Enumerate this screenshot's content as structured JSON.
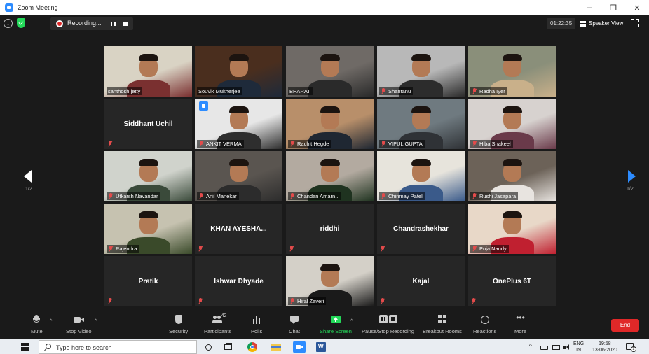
{
  "window": {
    "title": "Zoom Meeting",
    "controls": [
      "–",
      "❐",
      "✕"
    ]
  },
  "topbar": {
    "recording_label": "Recording...",
    "timer": "01:22:35",
    "view_label": "Speaker View"
  },
  "pager": {
    "left": "1/2",
    "right": "1/2"
  },
  "participants": [
    {
      "name": "santhosh jetty",
      "video": true,
      "muted": false,
      "colors": [
        "#d9d3c4",
        "#7a3030"
      ]
    },
    {
      "name": "Souvik Mukherjee",
      "video": true,
      "muted": false,
      "active": true,
      "colors": [
        "#4a2e1e",
        "#1e2a3a"
      ]
    },
    {
      "name": "BHARAT",
      "video": true,
      "muted": false,
      "colors": [
        "#6f6a66",
        "#2a2a2a"
      ]
    },
    {
      "name": "Shantanu",
      "video": true,
      "muted": true,
      "colors": [
        "#b8b8b8",
        "#2c2c2c"
      ]
    },
    {
      "name": "Radha Iyer",
      "video": true,
      "muted": true,
      "colors": [
        "#8a8f7a",
        "#c9b08a"
      ]
    },
    {
      "name": "Siddhant Uchil",
      "video": false,
      "muted": true
    },
    {
      "name": "ANKIT VERMA",
      "video": true,
      "muted": true,
      "raised_hand": true,
      "colors": [
        "#e7e7e7",
        "#2e2e2e"
      ]
    },
    {
      "name": "Rachit Hegde",
      "video": true,
      "muted": true,
      "colors": [
        "#b88f6a",
        "#1f2732"
      ]
    },
    {
      "name": "VIPUL GUPTA",
      "video": true,
      "muted": true,
      "colors": [
        "#6f7a80",
        "#2f3236"
      ]
    },
    {
      "name": "Hiba Shakeel",
      "video": true,
      "muted": true,
      "colors": [
        "#d7d2cf",
        "#6a3a4a"
      ]
    },
    {
      "name": "Utkarsh Navandar",
      "video": true,
      "muted": true,
      "colors": [
        "#d0d3cc",
        "#3a4a3a"
      ]
    },
    {
      "name": "Anil Manekar",
      "video": true,
      "muted": true,
      "colors": [
        "#5a5550",
        "#2c2c2c"
      ]
    },
    {
      "name": "Chandan Amarn...",
      "video": true,
      "muted": true,
      "colors": [
        "#b3aaa0",
        "#1f3320"
      ]
    },
    {
      "name": "Chinmay Patel",
      "video": true,
      "muted": true,
      "colors": [
        "#e7e4dc",
        "#3a5a8a"
      ]
    },
    {
      "name": "Rushi Jasapara",
      "video": true,
      "muted": true,
      "colors": [
        "#6c6258",
        "#e8e4e0"
      ]
    },
    {
      "name": "Rajendra",
      "video": true,
      "muted": true,
      "colors": [
        "#c6c2b0",
        "#3a4a2a"
      ]
    },
    {
      "name": "KHAN AYESHA...",
      "video": false,
      "muted": true
    },
    {
      "name": "riddhi",
      "video": false,
      "muted": true
    },
    {
      "name": "Chandrashekhar",
      "video": false,
      "muted": true
    },
    {
      "name": "Puja Nandy",
      "video": true,
      "muted": true,
      "colors": [
        "#e8d8c8",
        "#c02030"
      ]
    },
    {
      "name": "Pratik",
      "video": false,
      "muted": true
    },
    {
      "name": "Ishwar Dhyade",
      "video": false,
      "muted": true
    },
    {
      "name": "Hiral Zaveri",
      "video": true,
      "muted": true,
      "colors": [
        "#d4d0c8",
        "#1a1a1a"
      ]
    },
    {
      "name": "Kajal",
      "video": false,
      "muted": true
    },
    {
      "name": "OnePlus 6T",
      "video": false,
      "muted": true
    }
  ],
  "toolbar": {
    "mute": "Mute",
    "stop_video": "Stop Video",
    "security": "Security",
    "participants": "Participants",
    "participants_count": "42",
    "polls": "Polls",
    "chat": "Chat",
    "share_screen": "Share Screen",
    "pause_stop_recording": "Pause/Stop Recording",
    "breakout_rooms": "Breakout Rooms",
    "reactions": "Reactions",
    "more": "More",
    "end": "End",
    "accent": "#23d959",
    "end_color": "#e02828"
  },
  "taskbar": {
    "search_placeholder": "Type here to search",
    "lang_line1": "ENG",
    "lang_line2": "IN",
    "time": "19:58",
    "date": "13-06-2020",
    "notif_count": "2"
  }
}
